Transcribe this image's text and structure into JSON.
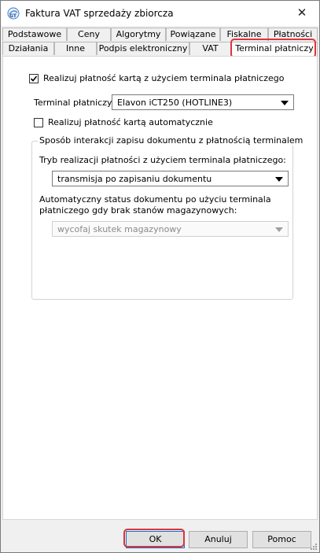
{
  "window": {
    "title": "Faktura VAT sprzedaży zbiorcza",
    "close_glyph": "✕",
    "app_icon": "app-logo-icon"
  },
  "tabs_row1": [
    "Podstawowe",
    "Ceny",
    "Algorytmy",
    "Powiązane",
    "Fiskalne",
    "Płatności"
  ],
  "tabs_row2": [
    "Działania",
    "Inne",
    "Podpis elektroniczny",
    "VAT",
    "Terminal płatniczy"
  ],
  "active_tab": "Terminal płatniczy",
  "terminal": {
    "use_terminal_label": "Realizuj płatność kartą z użyciem terminala płatniczego",
    "use_terminal_checked": true,
    "terminal_label": "Terminal płatniczy:",
    "terminal_value": "Elavon iCT250 (HOTLINE3)",
    "auto_label": "Realizuj płatność kartą automatycznie",
    "auto_checked": false
  },
  "interaction_group": {
    "title": "Sposób interakcji zapisu dokumentu z płatnością terminalem",
    "mode_label": "Tryb realizacji płatności z użyciem terminala płatniczego:",
    "mode_value": "transmisja po zapisaniu dokumentu",
    "status_label_line1": "Automatyczny status dokumentu po użyciu terminala",
    "status_label_line2": "płatniczego gdy brak stanów magazynowych:",
    "status_value": "wycofaj skutek magazynowy"
  },
  "buttons": {
    "ok": "OK",
    "cancel": "Anuluj",
    "help": "Pomoc"
  },
  "highlight_color": "#e0323a"
}
